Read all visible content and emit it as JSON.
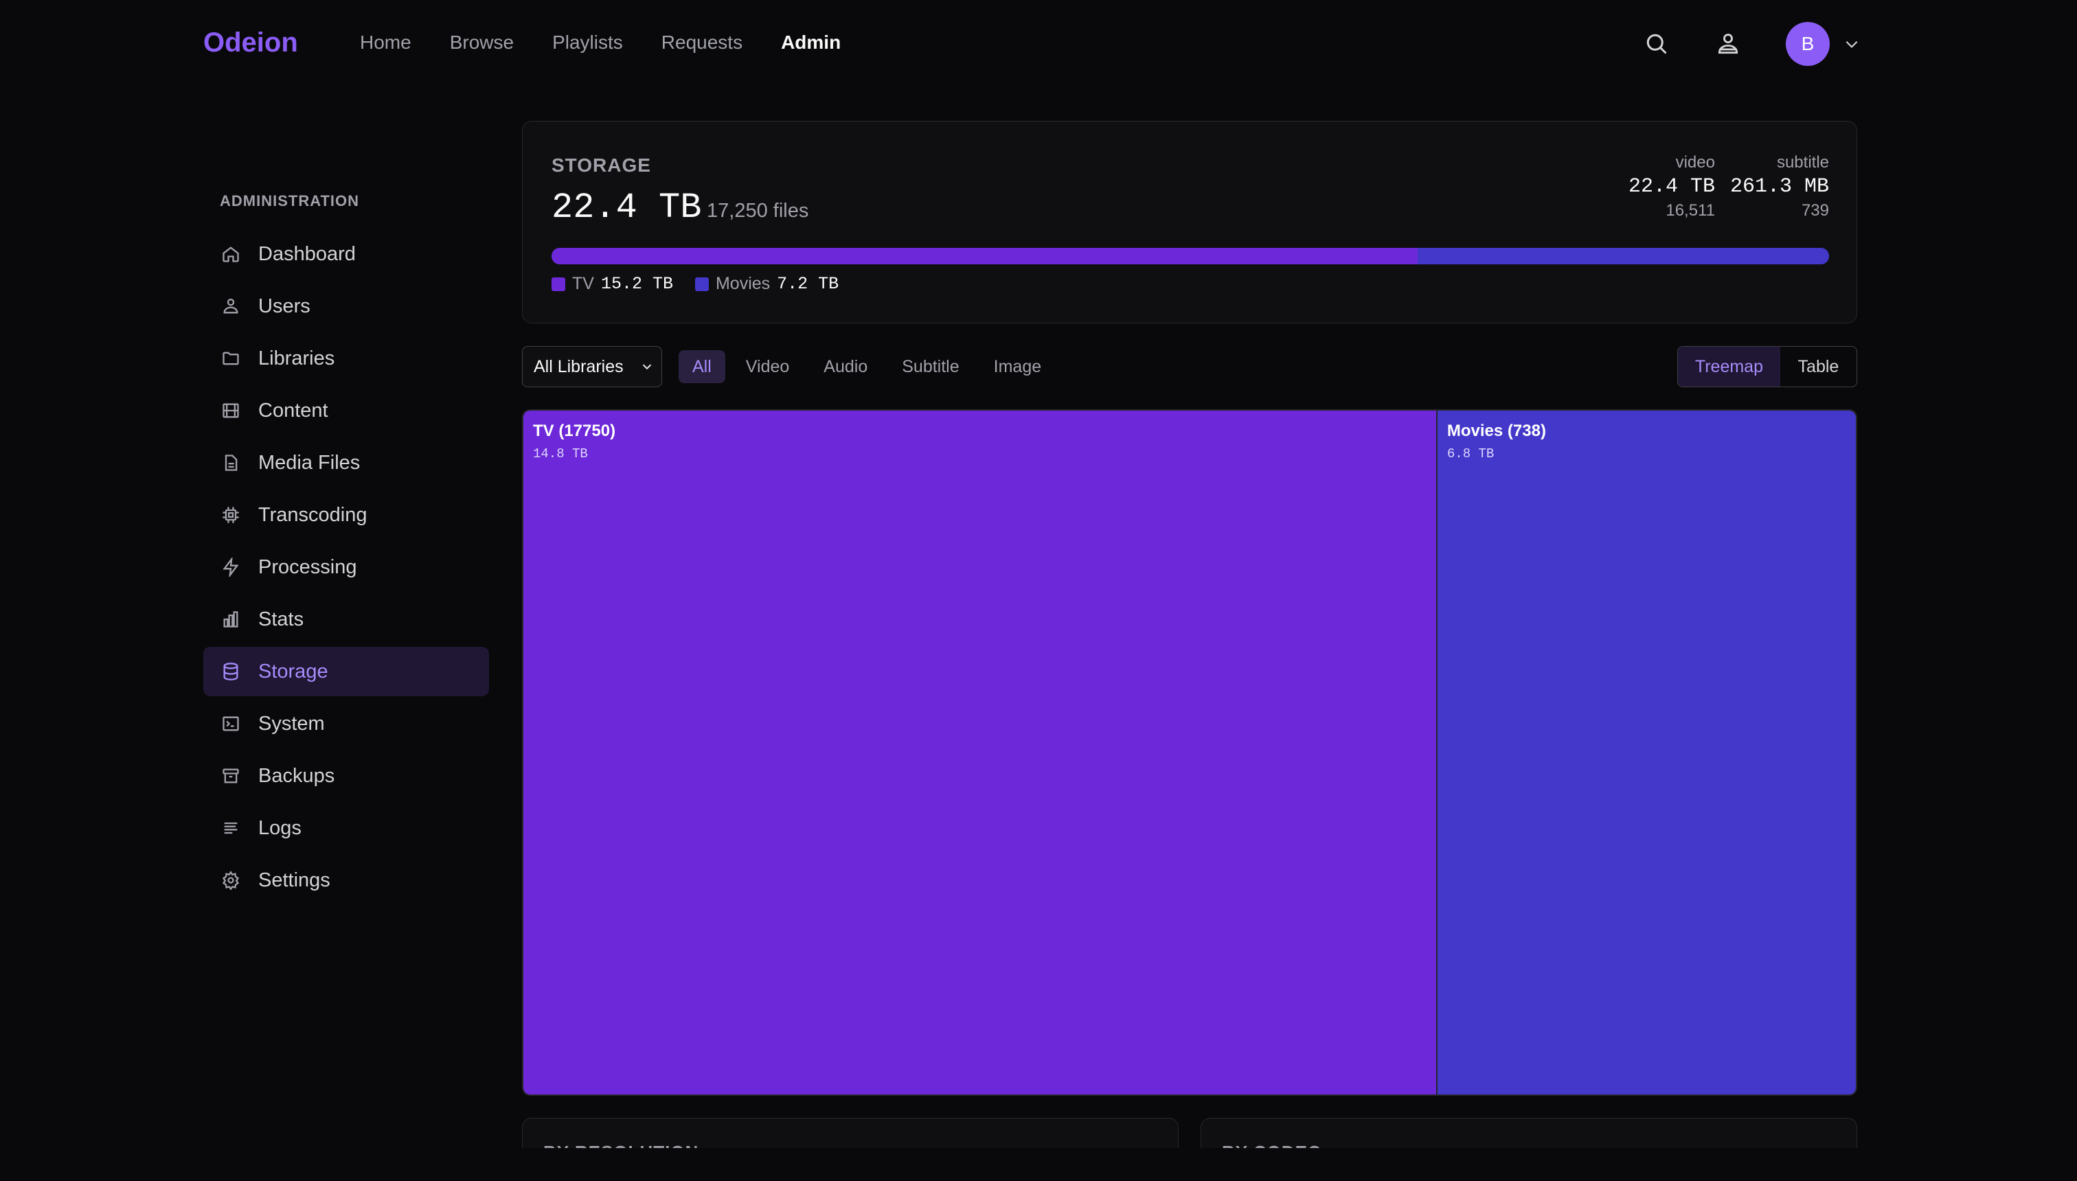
{
  "brand": "Odeion",
  "nav": {
    "links": [
      "Home",
      "Browse",
      "Playlists",
      "Requests",
      "Admin"
    ],
    "active": "Admin",
    "avatar_initial": "B"
  },
  "sidebar": {
    "heading": "ADMINISTRATION",
    "items": [
      {
        "label": "Dashboard",
        "icon": "home-icon"
      },
      {
        "label": "Users",
        "icon": "users-icon"
      },
      {
        "label": "Libraries",
        "icon": "folder-icon"
      },
      {
        "label": "Content",
        "icon": "film-icon"
      },
      {
        "label": "Media Files",
        "icon": "file-icon"
      },
      {
        "label": "Transcoding",
        "icon": "cpu-icon"
      },
      {
        "label": "Processing",
        "icon": "bolt-icon"
      },
      {
        "label": "Stats",
        "icon": "bar-chart-icon"
      },
      {
        "label": "Storage",
        "icon": "database-icon",
        "active": true
      },
      {
        "label": "System",
        "icon": "terminal-icon"
      },
      {
        "label": "Backups",
        "icon": "archive-icon"
      },
      {
        "label": "Logs",
        "icon": "lines-icon"
      },
      {
        "label": "Settings",
        "icon": "gear-icon"
      }
    ]
  },
  "storage": {
    "title": "STORAGE",
    "total": "22.4 TB",
    "files": "17,250 files",
    "types": [
      {
        "type": "video",
        "size": "22.4 TB",
        "count": "16,511"
      },
      {
        "type": "subtitle",
        "size": "261.3 MB",
        "count": "739"
      }
    ],
    "usage_bar": [
      {
        "name": "TV",
        "fraction": 0.678,
        "color": "#6d28d9"
      },
      {
        "name": "Movies",
        "fraction": 0.322,
        "color": "#4338ca"
      }
    ],
    "legend": [
      {
        "name": "TV",
        "value": "15.2 TB",
        "color": "#6d28d9"
      },
      {
        "name": "Movies",
        "value": "7.2 TB",
        "color": "#4338ca"
      }
    ]
  },
  "filters": {
    "library_select": "All Libraries",
    "types": [
      "All",
      "Video",
      "Audio",
      "Subtitle",
      "Image"
    ],
    "active_type": "All",
    "view_modes": [
      "Treemap",
      "Table"
    ],
    "active_view": "Treemap"
  },
  "treemap": {
    "tiles": [
      {
        "label": "TV (17750)",
        "size": "14.8 TB",
        "fraction": 0.685,
        "color": "#6d28d9"
      },
      {
        "label": "Movies (738)",
        "size": "6.8 TB",
        "fraction": 0.315,
        "color": "#4338ca"
      }
    ]
  },
  "bottom_cards": [
    "BY RESOLUTION",
    "BY CODEC"
  ]
}
